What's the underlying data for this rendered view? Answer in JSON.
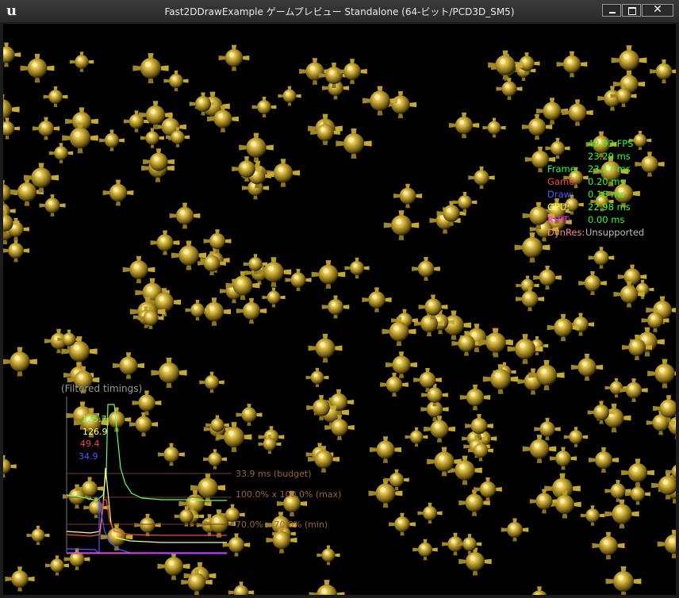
{
  "window": {
    "logo": "u",
    "title": "Fast2DDrawExample ゲームプレビュー Standalone (64-ビット/PCD3D_SM5)",
    "close_glyph": "✕"
  },
  "stats": {
    "fps": "42.93 FPS",
    "ms": "23.29 ms",
    "rows": [
      {
        "label": "Frame:",
        "value": "23.17 ms",
        "label_color": "#33ff33"
      },
      {
        "label": "Game:",
        "value": "0.20 ms",
        "label_color": "#ff4444"
      },
      {
        "label": "Draw:",
        "value": "0.18 ms",
        "label_color": "#5555ff"
      },
      {
        "label": "GPU:",
        "value": "22.98 ms",
        "label_color": "#ffff66"
      },
      {
        "label": "RHIT:",
        "value": "0.00 ms",
        "label_color": "#ff33ff"
      },
      {
        "label": "DynRes:",
        "value": "Unsupported",
        "label_color": "#ff8888"
      }
    ],
    "value_color": "#33ff33",
    "unsupported_color": "#bbbbbb"
  },
  "timing_graph": {
    "title": "(Filtered timings)",
    "peaks": [
      {
        "value": "125.7",
        "color": "#66ff66"
      },
      {
        "value": "126.9",
        "color": "#ffff88"
      },
      {
        "value": "49.4",
        "color": "#ff4444"
      },
      {
        "value": "34.9",
        "color": "#5555ff"
      }
    ],
    "budget_label": "33.9 ms (budget)",
    "max_label": "100.0% x 100.0% (max)",
    "min_label": "70.0% x 70.0% (min)",
    "label_color": "#996633"
  },
  "colors": {
    "sprite_gold": "#d4b43c",
    "background": "#000000"
  }
}
